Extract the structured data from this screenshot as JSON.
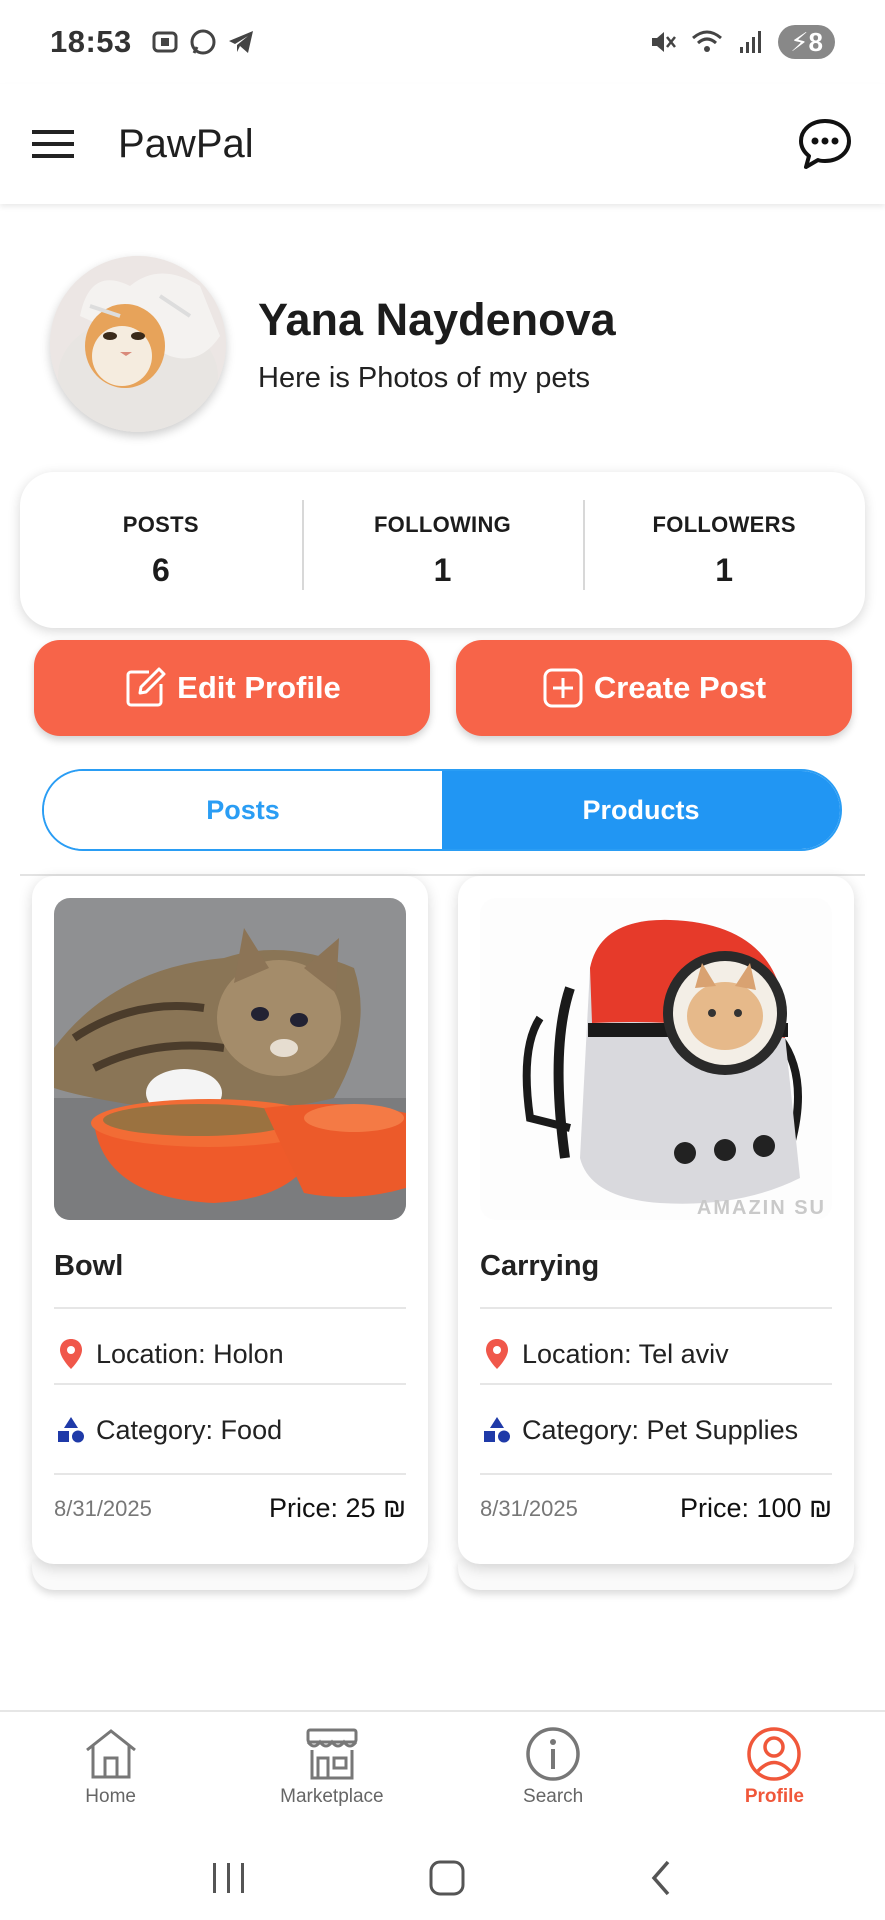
{
  "status_bar": {
    "time": "18:53",
    "battery": "8"
  },
  "app_bar": {
    "title": "PawPal"
  },
  "profile": {
    "name": "Yana Naydenova",
    "bio": "Here is Photos of my pets"
  },
  "stats": [
    {
      "label": "POSTS",
      "value": "6"
    },
    {
      "label": "FOLLOWING",
      "value": "1"
    },
    {
      "label": "FOLLOWERS",
      "value": "1"
    }
  ],
  "actions": {
    "edit_profile": "Edit Profile",
    "create_post": "Create Post"
  },
  "tabs": [
    {
      "label": "Posts",
      "active": false
    },
    {
      "label": "Products",
      "active": true
    }
  ],
  "products": [
    {
      "title": "Bowl",
      "location": "Location: Holon",
      "category": "Category: Food",
      "date": "8/31/2025",
      "price": "Price: 25 ₪"
    },
    {
      "title": "Carrying",
      "location": "Location: Tel aviv",
      "category": "Category: Pet Supplies",
      "date": "8/31/2025",
      "price": "Price: 100 ₪",
      "watermark": "AMAZIN SU"
    }
  ],
  "bottom_nav": [
    {
      "label": "Home",
      "icon": "home-icon",
      "active": false
    },
    {
      "label": "Marketplace",
      "icon": "store-icon",
      "active": false
    },
    {
      "label": "Search",
      "icon": "info-icon",
      "active": false
    },
    {
      "label": "Profile",
      "icon": "profile-icon",
      "active": true
    }
  ],
  "colors": {
    "accent_orange": "#f76449",
    "accent_blue": "#2196f3",
    "active_nav": "#f0573a"
  }
}
